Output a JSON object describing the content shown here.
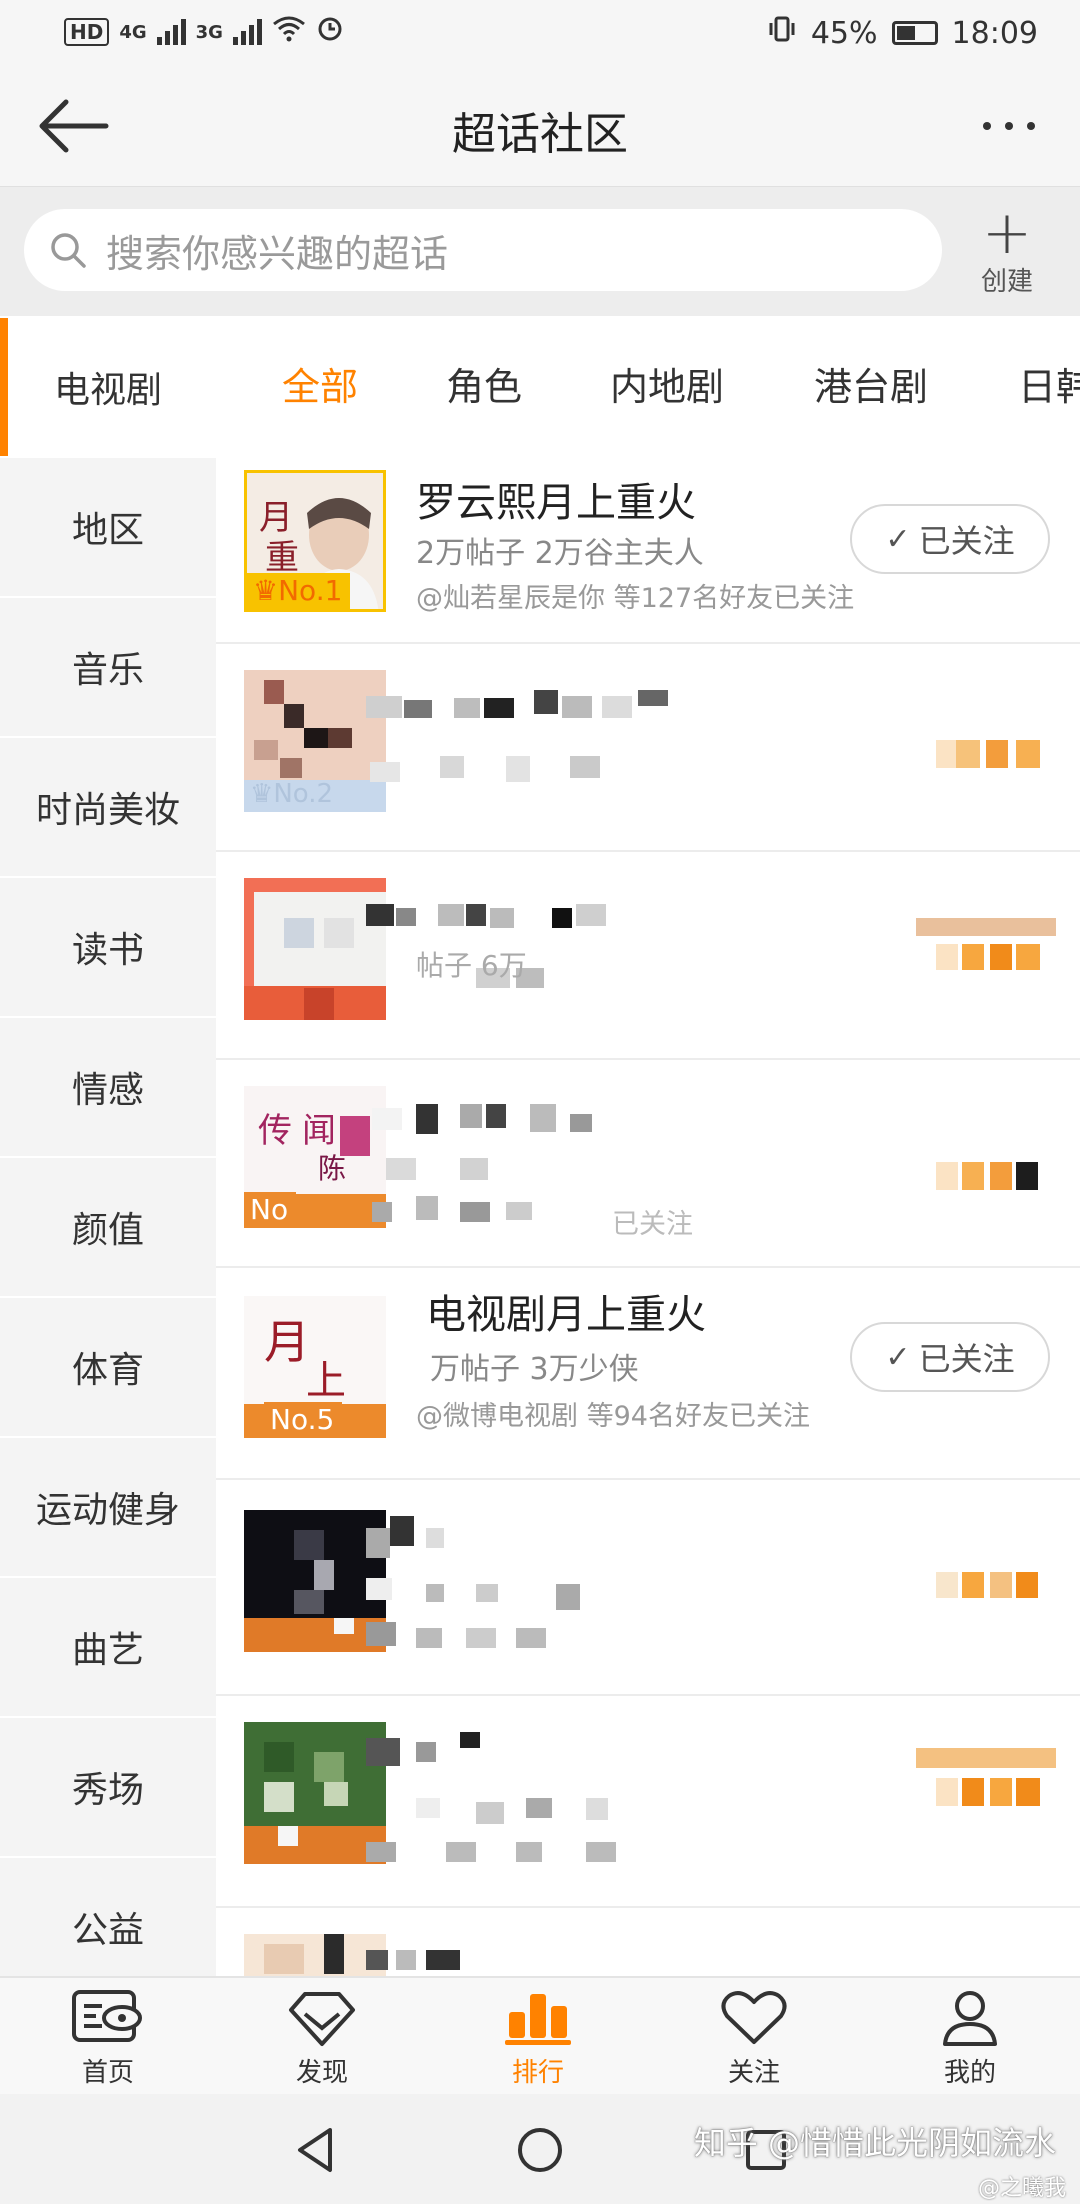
{
  "status_bar": {
    "hd": "HD",
    "net1": "4G",
    "net2": "3G",
    "battery": "45%",
    "time": "18:09"
  },
  "header": {
    "title": "超话社区",
    "back_icon": "arrow-left-icon",
    "more_icon": "more-dots-icon"
  },
  "search": {
    "placeholder": "搜索你感兴趣的超话",
    "create_label": "创建"
  },
  "sidebar": {
    "items": [
      {
        "label": "电视剧"
      },
      {
        "label": "地区"
      },
      {
        "label": "音乐"
      },
      {
        "label": "时尚美妆"
      },
      {
        "label": "读书"
      },
      {
        "label": "情感"
      },
      {
        "label": "颜值"
      },
      {
        "label": "体育"
      },
      {
        "label": "运动健身"
      },
      {
        "label": "曲艺"
      },
      {
        "label": "秀场"
      },
      {
        "label": "公益"
      }
    ]
  },
  "tabs": [
    {
      "label": "全部"
    },
    {
      "label": "角色"
    },
    {
      "label": "内地剧"
    },
    {
      "label": "港台剧"
    },
    {
      "label": "日韩"
    }
  ],
  "list": [
    {
      "rank": "No.1",
      "title": "罗云熙月上重火",
      "meta": "2万帖子 2万谷主夫人",
      "friends": "@灿若星辰是你 等127名好友已关注",
      "follow": "已关注"
    },
    {
      "rank": "No.2",
      "title": "",
      "meta": "",
      "friends": "",
      "follow": ""
    },
    {
      "rank": "",
      "title": "",
      "meta": "帖子 6万",
      "friends": "",
      "follow": ""
    },
    {
      "rank": "No",
      "title": "",
      "meta": "",
      "friends": "已关注",
      "follow": ""
    },
    {
      "rank": "No.5",
      "title": "电视剧月上重火",
      "meta": "万帖子 3万少侠",
      "friends": "@微博电视剧 等94名好友已关注",
      "follow": "已关注"
    }
  ],
  "bottom_nav": [
    {
      "label": "首页",
      "icon": "home-feed-icon"
    },
    {
      "label": "发现",
      "icon": "discover-diamond-icon"
    },
    {
      "label": "排行",
      "icon": "ranking-bars-icon"
    },
    {
      "label": "关注",
      "icon": "heart-icon"
    },
    {
      "label": "我的",
      "icon": "profile-icon"
    }
  ],
  "watermark": "知乎 @惜惜此光阴如流水",
  "watermark_small": "@之曦我",
  "colors": {
    "accent": "#ff8200",
    "rank_gold": "#f8c200",
    "rank_orange": "#ec8a2c"
  }
}
